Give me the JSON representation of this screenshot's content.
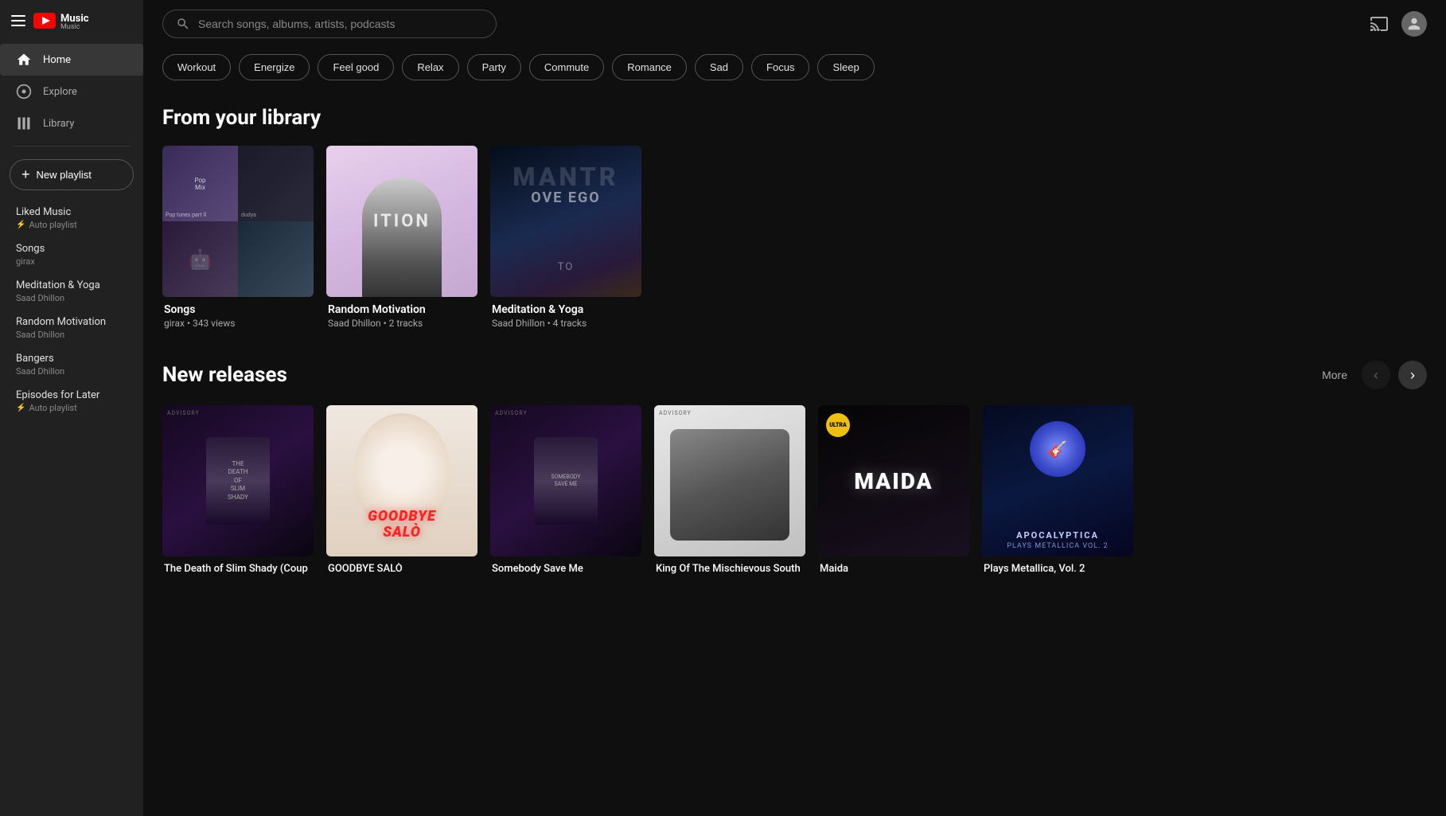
{
  "app": {
    "title": "Music",
    "logo_alt": "YouTube Music"
  },
  "sidebar": {
    "nav_items": [
      {
        "id": "home",
        "label": "Home",
        "active": true
      },
      {
        "id": "explore",
        "label": "Explore",
        "active": false
      },
      {
        "id": "library",
        "label": "Library",
        "active": false
      }
    ],
    "new_playlist_label": "New playlist",
    "library_items": [
      {
        "id": "liked-music",
        "title": "Liked Music",
        "subtitle": "Auto playlist",
        "is_auto": true
      },
      {
        "id": "songs",
        "title": "Songs",
        "subtitle": "girax",
        "is_auto": false
      },
      {
        "id": "meditation-yoga",
        "title": "Meditation & Yoga",
        "subtitle": "Saad Dhillon",
        "is_auto": false
      },
      {
        "id": "random-motivation",
        "title": "Random Motivation",
        "subtitle": "Saad Dhillon",
        "is_auto": false
      },
      {
        "id": "bangers",
        "title": "Bangers",
        "subtitle": "Saad Dhillon",
        "is_auto": false
      },
      {
        "id": "episodes-for-later",
        "title": "Episodes for Later",
        "subtitle": "Auto playlist",
        "is_auto": true
      }
    ]
  },
  "topbar": {
    "search_placeholder": "Search songs, albums, artists, podcasts"
  },
  "mood_chips": [
    {
      "id": "workout",
      "label": "Workout"
    },
    {
      "id": "energize",
      "label": "Energize"
    },
    {
      "id": "feel-good",
      "label": "Feel good"
    },
    {
      "id": "relax",
      "label": "Relax"
    },
    {
      "id": "party",
      "label": "Party"
    },
    {
      "id": "commute",
      "label": "Commute"
    },
    {
      "id": "romance",
      "label": "Romance"
    },
    {
      "id": "sad",
      "label": "Sad"
    },
    {
      "id": "focus",
      "label": "Focus"
    },
    {
      "id": "sleep",
      "label": "Sleep"
    }
  ],
  "from_library": {
    "section_title": "From your library",
    "cards": [
      {
        "id": "songs",
        "title": "Songs",
        "subtitle": "girax • 343 views",
        "thumb_type": "songs-grid"
      },
      {
        "id": "random-motivation",
        "title": "Random Motivation",
        "subtitle": "Saad Dhillon • 2 tracks",
        "thumb_type": "random-motivation"
      },
      {
        "id": "meditation-yoga",
        "title": "Meditation & Yoga",
        "subtitle": "Saad Dhillon • 4 tracks",
        "thumb_type": "meditation-yoga"
      }
    ]
  },
  "new_releases": {
    "section_title": "New releases",
    "more_label": "More",
    "cards": [
      {
        "id": "death-slim-shady",
        "title": "The Death of Slim Shady (Coup",
        "subtitle": "",
        "thumb_type": "release-1"
      },
      {
        "id": "goodbye-salo",
        "title": "GOODBYE SALÒ",
        "subtitle": "",
        "thumb_type": "release-2"
      },
      {
        "id": "somebody-save-me",
        "title": "Somebody Save Me",
        "subtitle": "",
        "thumb_type": "release-3"
      },
      {
        "id": "king-mischievous",
        "title": "King Of The Mischievous South",
        "subtitle": "",
        "thumb_type": "release-4"
      },
      {
        "id": "maida",
        "title": "Maida",
        "subtitle": "",
        "thumb_type": "release-5"
      },
      {
        "id": "plays-metallica",
        "title": "Plays Metallica, Vol. 2",
        "subtitle": "",
        "thumb_type": "release-6"
      }
    ]
  }
}
